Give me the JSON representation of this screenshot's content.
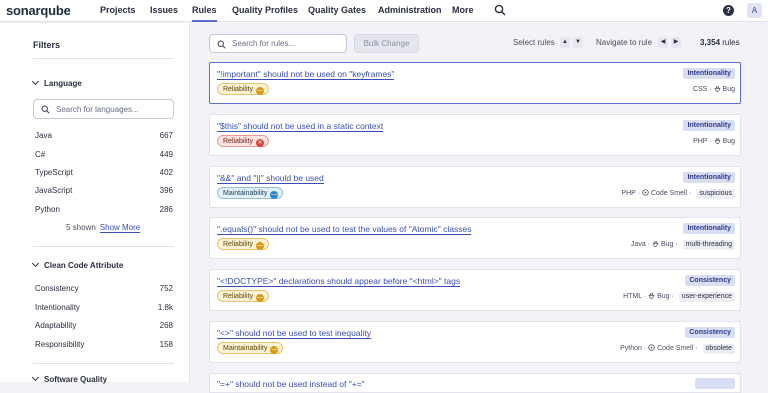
{
  "app": {
    "logo": "sonarqube"
  },
  "nav": {
    "items": [
      {
        "label": "Projects",
        "name": "nav-projects"
      },
      {
        "label": "Issues",
        "name": "nav-issues"
      },
      {
        "label": "Rules",
        "name": "nav-rules",
        "active": true
      },
      {
        "label": "Quality Profiles",
        "name": "nav-quality-profiles"
      },
      {
        "label": "Quality Gates",
        "name": "nav-quality-gates"
      },
      {
        "label": "Administration",
        "name": "nav-administration"
      },
      {
        "label": "More",
        "name": "nav-more"
      }
    ],
    "help_label": "?",
    "avatar_initial": "A"
  },
  "sidebar": {
    "title": "Filters",
    "language": {
      "heading": "Language",
      "search_placeholder": "Search for languages...",
      "items": [
        {
          "label": "Java",
          "count": "667"
        },
        {
          "label": "C#",
          "count": "449"
        },
        {
          "label": "TypeScript",
          "count": "402"
        },
        {
          "label": "JavaScript",
          "count": "396"
        },
        {
          "label": "Python",
          "count": "286"
        }
      ],
      "shown_text": "5 shown",
      "show_more": "Show More"
    },
    "clean_code": {
      "heading": "Clean Code Attribute",
      "items": [
        {
          "label": "Consistency",
          "count": "752"
        },
        {
          "label": "Intentionality",
          "count": "1.8k"
        },
        {
          "label": "Adaptability",
          "count": "268"
        },
        {
          "label": "Responsibility",
          "count": "158"
        }
      ]
    },
    "software_quality": {
      "heading": "Software Quality"
    }
  },
  "toolbar": {
    "search_placeholder": "Search for rules...",
    "bulk_change": "Bulk Change",
    "select_rules": "Select rules",
    "navigate_to_rule": "Navigate to rule",
    "total": "3,354",
    "total_suffix": "rules",
    "up": "▲",
    "down": "▼",
    "left": "◀",
    "right": "▶"
  },
  "rules": [
    {
      "title": "\"!important\" should not be used on \"keyframes\"",
      "attribute": "Intentionality",
      "quality": "Reliability",
      "severity": "med",
      "qclass": "rel-med",
      "lang": "CSS",
      "type": "Bug",
      "type_icon": "bug-icon",
      "tags": []
    },
    {
      "title": "\"$this\" should not be used in a static context",
      "attribute": "Intentionality",
      "quality": "Reliability",
      "severity": "high",
      "qclass": "rel-high",
      "lang": "PHP",
      "type": "Bug",
      "type_icon": "bug-icon",
      "tags": []
    },
    {
      "title": "\"&&\" and \"||\" should be used",
      "attribute": "Intentionality",
      "quality": "Maintainability",
      "severity": "low",
      "qclass": "main-low",
      "lang": "PHP",
      "type": "Code Smell",
      "type_icon": "code-smell-icon",
      "tags": [
        "suspicious"
      ]
    },
    {
      "title": "\".equals()\" should not be used to test the values of \"Atomic\" classes",
      "attribute": "Intentionality",
      "quality": "Reliability",
      "severity": "med",
      "qclass": "rel-med",
      "lang": "Java",
      "type": "Bug",
      "type_icon": "bug-icon",
      "tags": [
        "multi-threading"
      ]
    },
    {
      "title": "\"<!DOCTYPE>\" declarations should appear before \"<html>\" tags",
      "attribute": "Consistency",
      "quality": "Reliability",
      "severity": "med",
      "qclass": "rel-med",
      "lang": "HTML",
      "type": "Bug",
      "type_icon": "bug-icon",
      "tags": [
        "user-experience"
      ]
    },
    {
      "title": "\"<>\" should not be used to test inequality",
      "attribute": "Consistency",
      "quality": "Maintainability",
      "severity": "med",
      "qclass": "main-med",
      "lang": "Python",
      "type": "Code Smell",
      "type_icon": "code-smell-icon",
      "tags": [
        "obsolete"
      ]
    }
  ],
  "partial_rule": {
    "title": "\"=+\" should not be used instead of \"+=\""
  },
  "colors": {
    "accent": "#5d6cd0",
    "link": "#3b4fb2",
    "background": "#f3f3f7"
  }
}
